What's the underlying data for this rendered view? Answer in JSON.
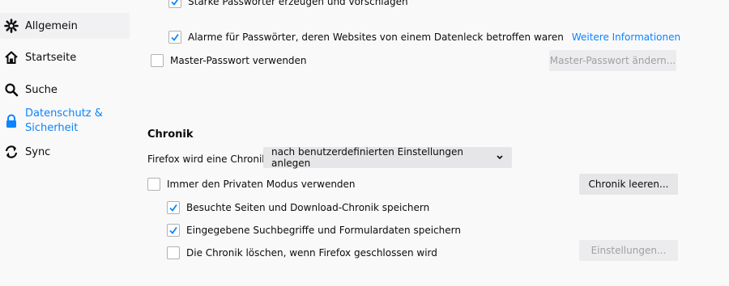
{
  "sidebar": {
    "items": [
      {
        "label": "Allgemein",
        "icon": "gear-icon"
      },
      {
        "label": "Startseite",
        "icon": "home-icon"
      },
      {
        "label": "Suche",
        "icon": "search-icon"
      },
      {
        "label": "Datenschutz &",
        "label2": "Sicherheit",
        "icon": "lock-icon"
      },
      {
        "label": "Sync",
        "icon": "sync-icon"
      }
    ]
  },
  "passwords": {
    "strong_label": "Starke Passwörter erzeugen und vorschlagen",
    "breach_label": "Alarme für Passwörter, deren Websites von einem Datenleck betroffen waren",
    "breach_link": "Weitere Informationen",
    "master_label": "Master-Passwort verwenden",
    "master_button": "Master-Passwort ändern..."
  },
  "history": {
    "heading": "Chronik",
    "mode_label": "Firefox wird eine Chronik",
    "mode_value": "nach benutzerdefinierten Einstellungen anlegen",
    "private_label": "Immer den Privaten Modus verwenden",
    "clear_button": "Chronik leeren...",
    "visited_label": "Besuchte Seiten und Download-Chronik speichern",
    "search_label": "Eingegebene Suchbegriffe und Formulardaten speichern",
    "clear_on_close_label": "Die Chronik löschen, wenn Firefox geschlossen wird",
    "settings_button": "Einstellungen..."
  },
  "colors": {
    "accent": "#0a84ff",
    "background": "#f9f9fa",
    "button": "#e6e6e8"
  }
}
